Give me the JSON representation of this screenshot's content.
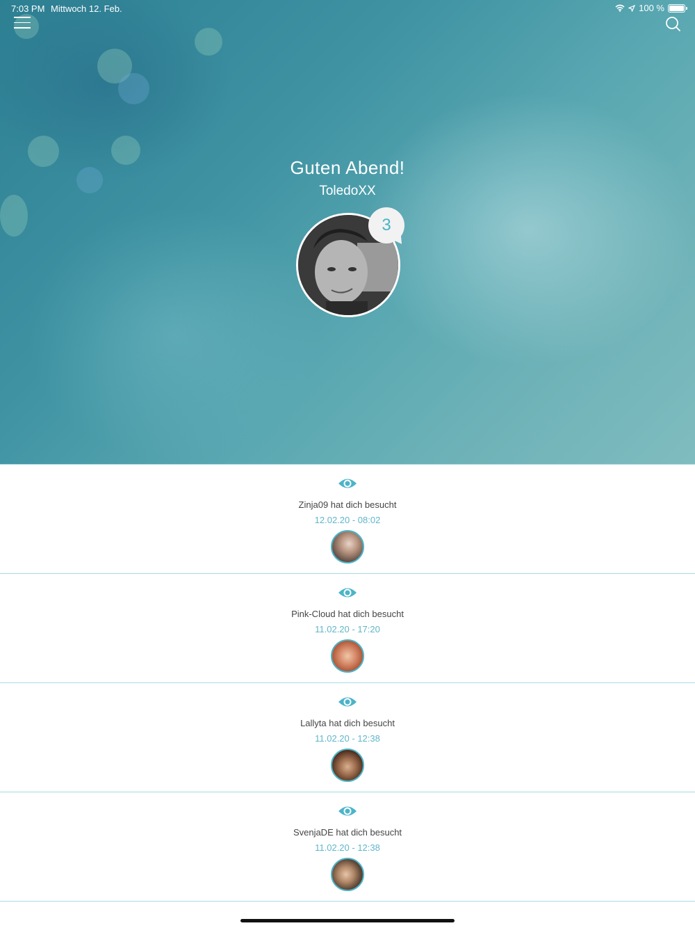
{
  "status_bar": {
    "time": "7:03 PM",
    "date": "Mittwoch 12. Feb.",
    "battery": "100 %"
  },
  "header": {
    "greeting": "Guten Abend!",
    "username": "ToledoXX",
    "notification_count": "3"
  },
  "visits": [
    {
      "message": "Zinja09 hat dich besucht",
      "timestamp": "12.02.20 - 08:02"
    },
    {
      "message": "Pink-Cloud hat dich besucht",
      "timestamp": "11.02.20 - 17:20"
    },
    {
      "message": "Lallyta hat dich besucht",
      "timestamp": "11.02.20 - 12:38"
    },
    {
      "message": "SvenjaDE hat dich besucht",
      "timestamp": "11.02.20 - 12:38"
    }
  ],
  "icons": {
    "menu": "hamburger-icon",
    "search": "search-icon",
    "visit": "eye-icon"
  },
  "colors": {
    "accent": "#4cb4c9",
    "timestamp": "#5fb6ca",
    "divider": "#a6dbe4"
  }
}
